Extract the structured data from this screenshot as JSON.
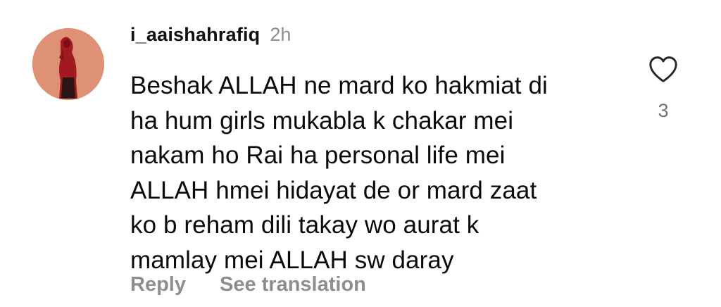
{
  "comment": {
    "username": "i_aaishahrafiq",
    "timestamp": "2h",
    "lines": [
      "Beshak ALLAH ne mard ko hakmiat di",
      "ha hum girls mukabla k chakar mei",
      "nakam ho Rai ha personal life mei",
      "ALLAH hmei hidayat de or mard zaat",
      "ko b reham dili takay wo aurat k",
      "mamlay mei ALLAH sw daray"
    ],
    "like_count": "3",
    "like_icon": "heart-outline-icon",
    "actions": {
      "reply_label": "Reply",
      "translate_label": "See translation"
    }
  },
  "colors": {
    "text": "#0a0a0a",
    "muted": "#8e8e8e",
    "avatar_bg": "#e39a7c",
    "avatar_figure": "#a01a20"
  }
}
